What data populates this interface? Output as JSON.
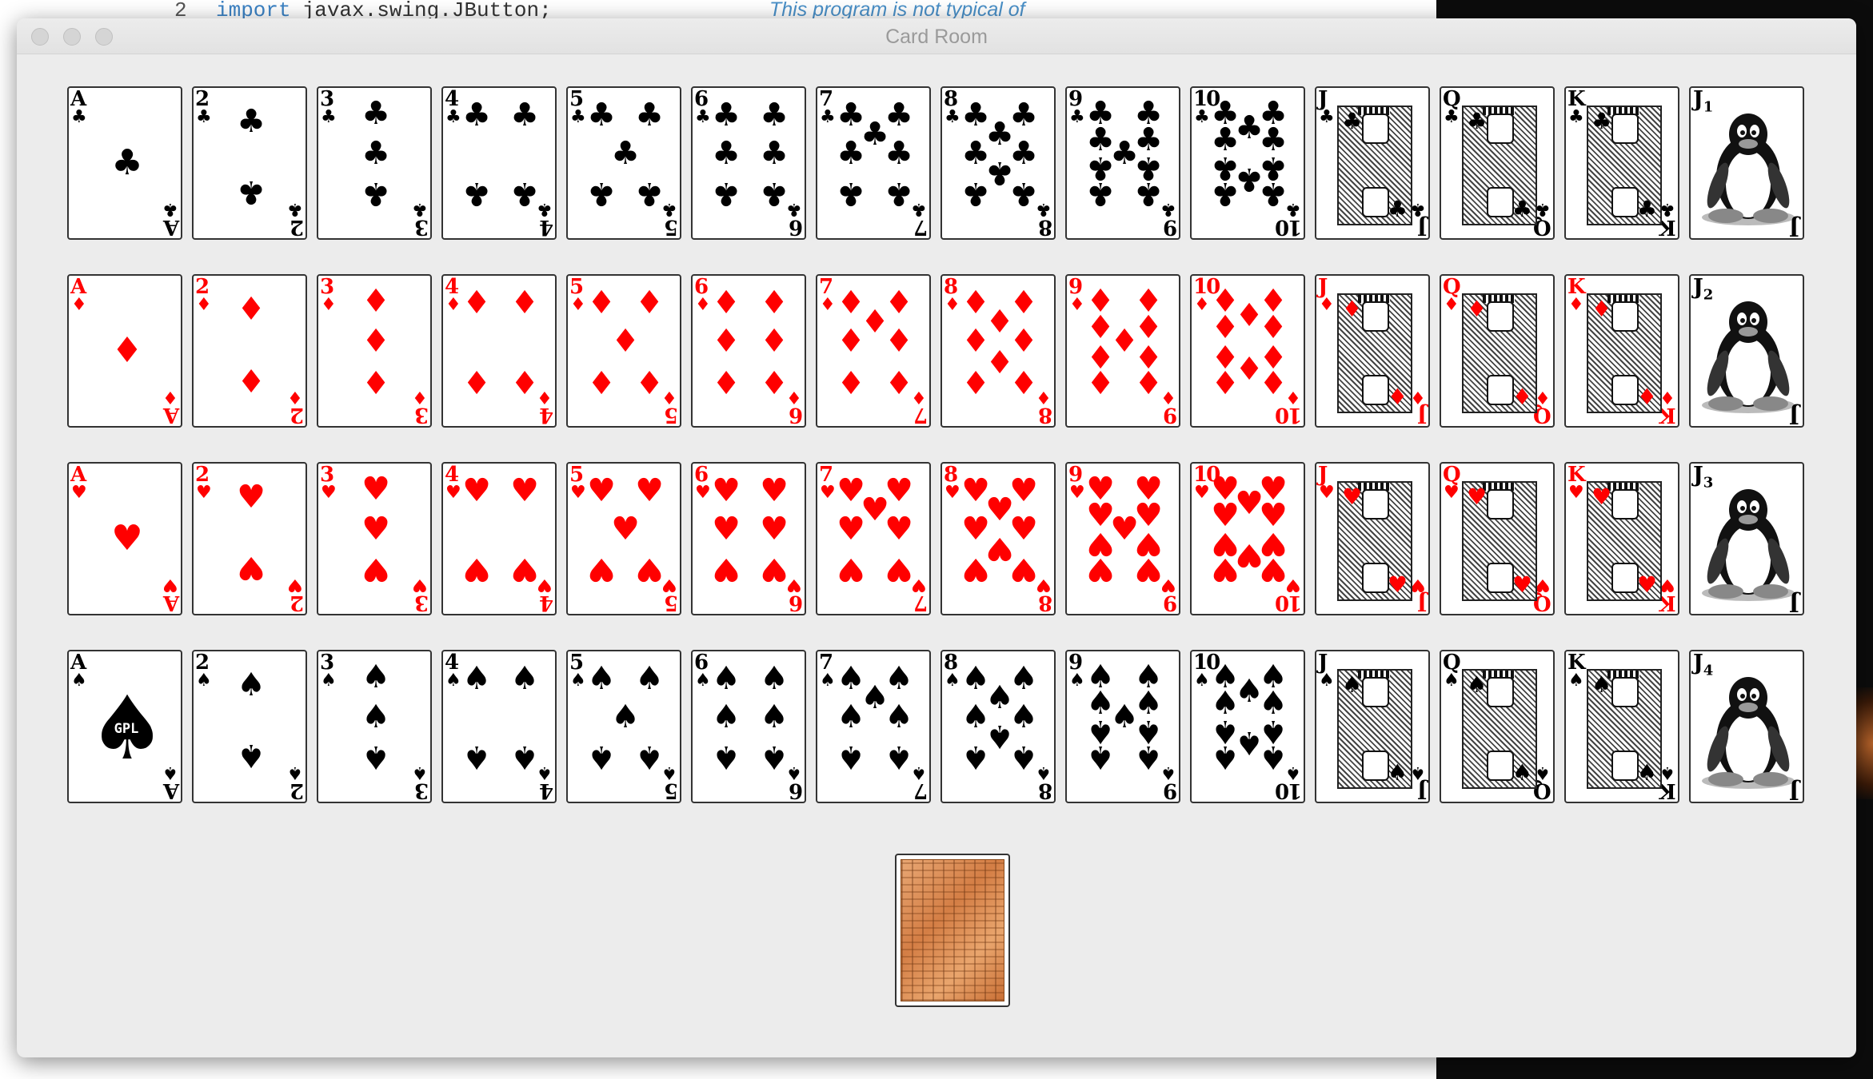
{
  "editor": {
    "line_number": "2",
    "code_keyword": "import",
    "code_rest": "javax.swing.JButton;",
    "comment": "This program is not typical of"
  },
  "window": {
    "title": "Card Room"
  },
  "rows": [
    {
      "suit": "clubs",
      "symbol": "♣",
      "color": "black",
      "cards": [
        "A",
        "2",
        "3",
        "4",
        "5",
        "6",
        "7",
        "8",
        "9",
        "10",
        "J",
        "Q",
        "K"
      ],
      "joker": "J",
      "joker_index": "1"
    },
    {
      "suit": "diamonds",
      "symbol": "♦",
      "color": "red",
      "cards": [
        "A",
        "2",
        "3",
        "4",
        "5",
        "6",
        "7",
        "8",
        "9",
        "10",
        "J",
        "Q",
        "K"
      ],
      "joker": "J",
      "joker_index": "2"
    },
    {
      "suit": "hearts",
      "symbol": "♥",
      "color": "red",
      "cards": [
        "A",
        "2",
        "3",
        "4",
        "5",
        "6",
        "7",
        "8",
        "9",
        "10",
        "J",
        "Q",
        "K"
      ],
      "joker": "J",
      "joker_index": "3"
    },
    {
      "suit": "spades",
      "symbol": "♠",
      "color": "black",
      "cards": [
        "A",
        "2",
        "3",
        "4",
        "5",
        "6",
        "7",
        "8",
        "9",
        "10",
        "J",
        "Q",
        "K"
      ],
      "joker": "J",
      "joker_index": "4"
    }
  ],
  "ace_of_spades_logo": "GPL",
  "deck": {
    "label": "card back"
  },
  "colors": {
    "red_suit": "#ff0000",
    "black_suit": "#000000",
    "window_bg": "#ececec"
  }
}
